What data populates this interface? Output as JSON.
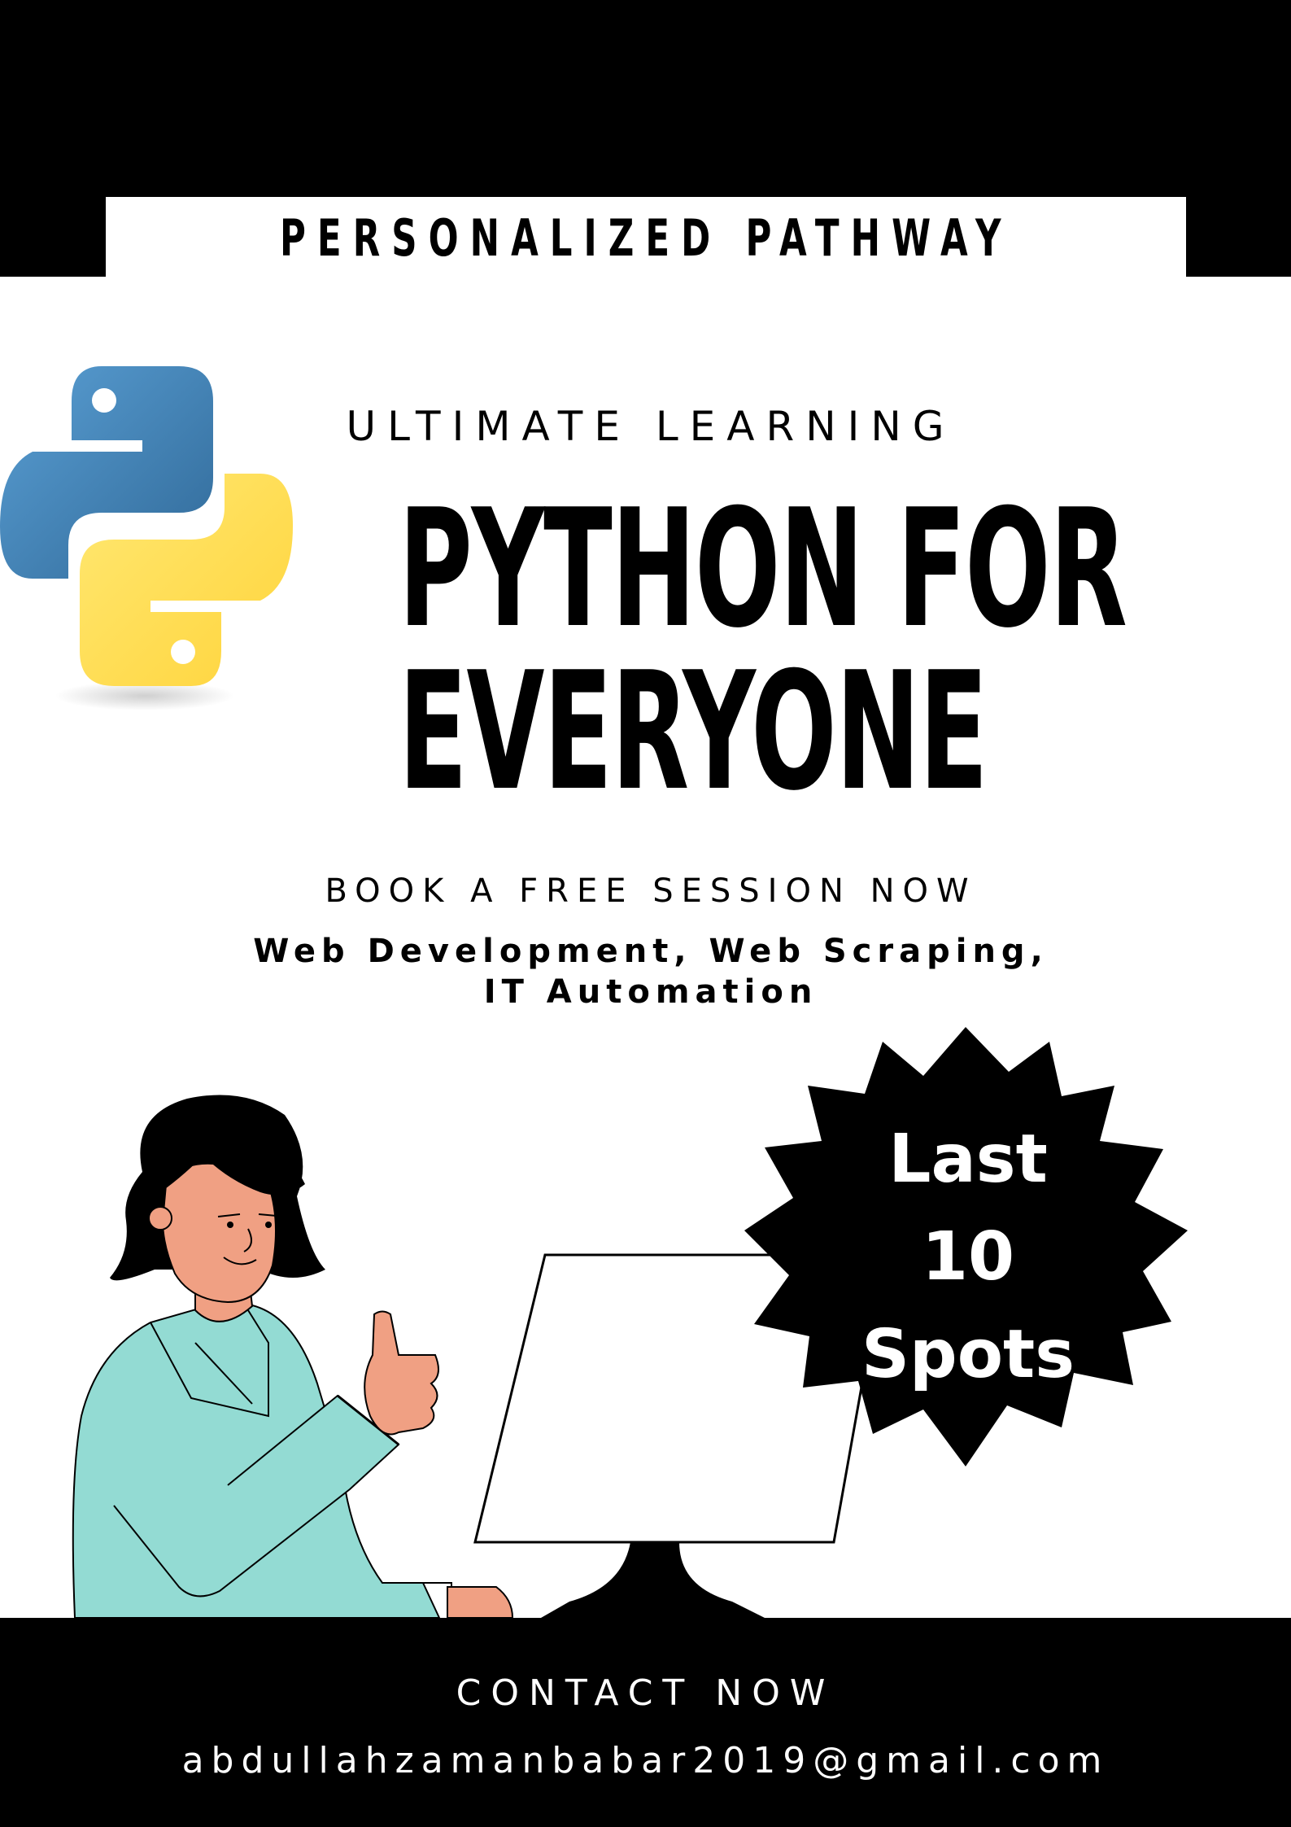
{
  "header": {
    "ribbon_label": "PERSONALIZED PATHWAY"
  },
  "hero": {
    "subtitle": "ULTIMATE LEARNING",
    "title_line1": "PYTHON FOR",
    "title_line2": "EVERYONE"
  },
  "offer": {
    "book_label": "BOOK A FREE SESSION NOW",
    "topics_line1": "Web Development, Web Scraping,",
    "topics_line2": "IT Automation"
  },
  "badge": {
    "line1": "Last",
    "line2": "10",
    "line3": "Spots"
  },
  "footer": {
    "contact_label": "CONTACT NOW",
    "email": "abdullahzamanbabar2019@gmail.com"
  },
  "icons": {
    "logo": "python-logo-icon",
    "illustration": "woman-at-computer-thumbs-up"
  },
  "colors": {
    "background": "#ffffff",
    "band": "#000000",
    "python_blue": "#3f7ab5",
    "python_yellow": "#ffd43b",
    "shirt": "#93dbd3",
    "skin": "#f0a083"
  }
}
